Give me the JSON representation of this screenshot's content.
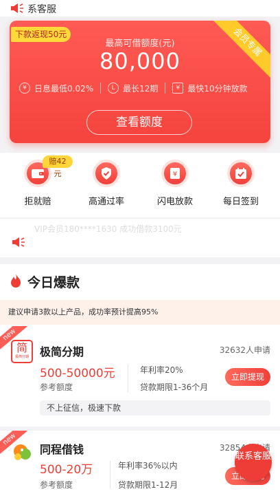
{
  "topbar": {
    "service_label": "系客服"
  },
  "hero": {
    "rebate_tag": "下款返现50元",
    "ribbon": "会员专属",
    "limit_caption": "最高可借额度(元)",
    "limit_amount": "80,000",
    "features": [
      {
        "icon": "yen-circle-icon",
        "label": "日息最低0.02%"
      },
      {
        "icon": "clock-circle-icon",
        "label": "最长12期"
      },
      {
        "icon": "yen-shield-icon",
        "label": "最快10分钟放款"
      }
    ],
    "cta_label": "查看额度"
  },
  "quick_actions": [
    {
      "icon": "wallet-icon",
      "label": "拒就赔",
      "badge": "赔42元"
    },
    {
      "icon": "shield-check-icon",
      "label": "高通过率"
    },
    {
      "icon": "yen-bolt-icon",
      "label": "闪电放款"
    },
    {
      "icon": "calendar-check-icon",
      "label": "每日签到"
    }
  ],
  "notice": {
    "ghost_text": "VIP会员180****1630 成功借款3100元"
  },
  "hot": {
    "title": "今日爆款",
    "tip": "建议申请3款以上产品，成功率预计提高95%",
    "products": [
      {
        "name": "极简分期",
        "logo_char": "简",
        "logo_sub": "极简分期",
        "applicants": "32632人申请",
        "range": "500-50000元",
        "range_label": "参考额度",
        "rate": "年利率20%",
        "term": "贷款期限1-36个月",
        "button": "立即提现",
        "feature": "不上征信，极速下款",
        "new_tag": "new"
      },
      {
        "name": "同程借钱",
        "applicants": "32854人申请",
        "range": "500-20万",
        "range_label": "参考额度",
        "rate": "年利率36%以内",
        "term": "贷款期限1-12月",
        "button": "立即提现",
        "new_tag": "new"
      }
    ]
  },
  "floating": {
    "label": "联系客服"
  },
  "colors": {
    "primary": "#f5433d",
    "accent_yellow": "#ffd93a",
    "tip_bg": "#fdf1ea"
  }
}
